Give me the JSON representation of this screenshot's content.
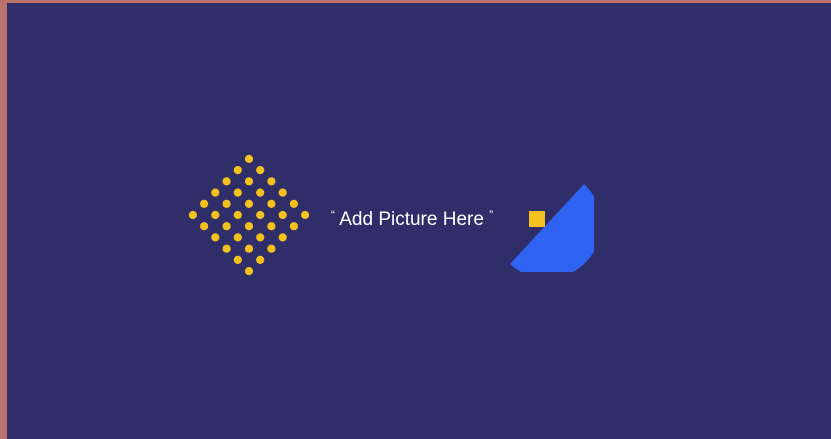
{
  "slide": {
    "placeholder": {
      "open_quote": "“",
      "text": "Add Picture Here",
      "close_quote": "”"
    }
  },
  "colors": {
    "border": "#b9726c",
    "background": "#2f2e68",
    "accent_yellow": "#f4c11f",
    "accent_blue": "#2f63f2",
    "text": "#ffffff"
  },
  "decor": {
    "dot_grid_icon": "dot-grid-diamond",
    "half_circle_icon": "half-circle-shape",
    "square_icon": "yellow-square"
  }
}
